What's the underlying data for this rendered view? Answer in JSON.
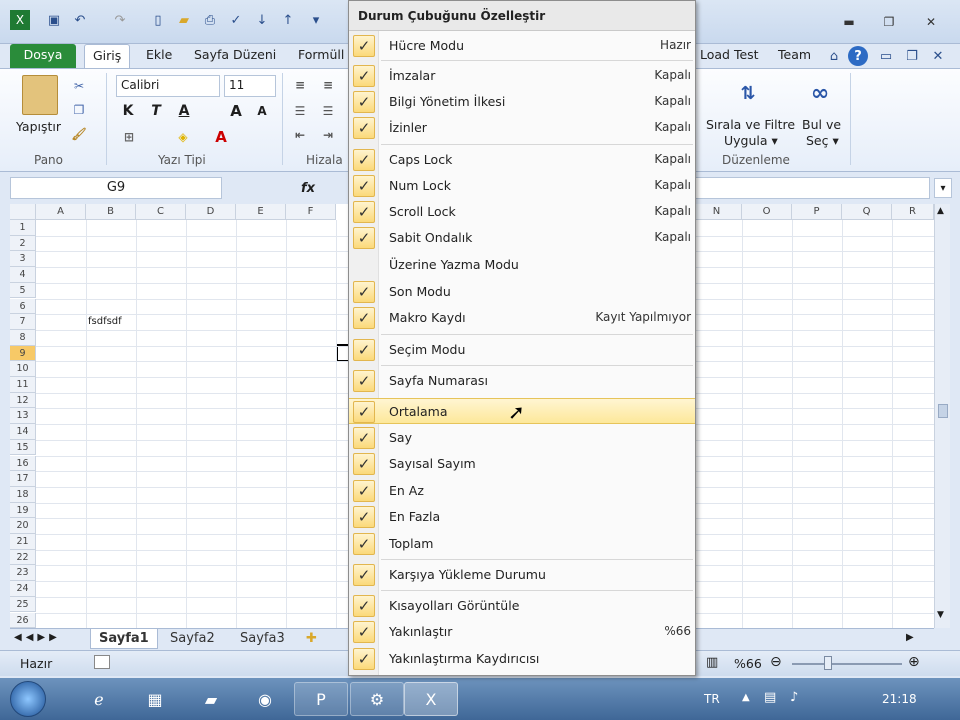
{
  "ribbon": {
    "tabs": [
      "Dosya",
      "Giriş",
      "Ekle",
      "Sayfa Düzeni",
      "Formüll",
      "Load Test",
      "Team"
    ],
    "paste_label": "Yapıştır",
    "font_name": "Calibri",
    "font_size": "11",
    "group_pano": "Pano",
    "group_yazi_tipi": "Yazı Tipi",
    "group_hizala": "Hizala",
    "group_duzenleme": "Düzenleme",
    "sort_label_1": "Sırala ve Filtre",
    "sort_label_2": "Uygula ▾",
    "find_label_1": "Bul ve",
    "find_label_2": "Seç ▾",
    "bold": "K",
    "italic": "T",
    "underline": "A",
    "grow_font": "A",
    "shrink_font": "A"
  },
  "formula_bar": {
    "name_box": "G9",
    "fx": "fx"
  },
  "grid": {
    "columns": [
      "A",
      "B",
      "C",
      "D",
      "E",
      "F",
      "N",
      "O",
      "P",
      "Q",
      "R"
    ],
    "rows": [
      "1",
      "2",
      "3",
      "4",
      "5",
      "6",
      "7",
      "8",
      "9",
      "10",
      "11",
      "12",
      "13",
      "14",
      "15",
      "16",
      "17",
      "18",
      "19",
      "20",
      "21",
      "22",
      "23",
      "24",
      "25",
      "26"
    ],
    "cell_b7": "fsdfsdf"
  },
  "sheets": [
    "Sayfa1",
    "Sayfa2",
    "Sayfa3"
  ],
  "status": {
    "ready": "Hazır",
    "zoom": "%66"
  },
  "taskbar": {
    "lang": "TR",
    "time": "21:18"
  },
  "menu": {
    "title": "Durum Çubuğunu Özelleştir",
    "items": [
      {
        "label": "Hücre Modu",
        "value": "Hazır",
        "checked": true
      },
      {
        "label": "İmzalar",
        "value": "Kapalı",
        "checked": true
      },
      {
        "label": "Bilgi Yönetim İlkesi",
        "value": "Kapalı",
        "checked": true
      },
      {
        "label": "İzinler",
        "value": "Kapalı",
        "checked": true
      },
      {
        "label": "Caps Lock",
        "value": "Kapalı",
        "checked": true
      },
      {
        "label": "Num Lock",
        "value": "Kapalı",
        "checked": true
      },
      {
        "label": "Scroll Lock",
        "value": "Kapalı",
        "checked": true
      },
      {
        "label": "Sabit Ondalık",
        "value": "Kapalı",
        "checked": true
      },
      {
        "label": "Üzerine Yazma Modu",
        "value": "",
        "checked": false
      },
      {
        "label": "Son Modu",
        "value": "",
        "checked": true
      },
      {
        "label": "Makro Kaydı",
        "value": "Kayıt Yapılmıyor",
        "checked": true
      },
      {
        "label": "Seçim Modu",
        "value": "",
        "checked": true
      },
      {
        "label": "Sayfa Numarası",
        "value": "",
        "checked": true
      },
      {
        "label": "Ortalama",
        "value": "",
        "checked": true
      },
      {
        "label": "Say",
        "value": "",
        "checked": true
      },
      {
        "label": "Sayısal Sayım",
        "value": "",
        "checked": true
      },
      {
        "label": "En Az",
        "value": "",
        "checked": true
      },
      {
        "label": "En Fazla",
        "value": "",
        "checked": true
      },
      {
        "label": "Toplam",
        "value": "",
        "checked": true
      },
      {
        "label": "Karşıya Yükleme Durumu",
        "value": "",
        "checked": true
      },
      {
        "label": "Kısayolları Görüntüle",
        "value": "",
        "checked": true
      },
      {
        "label": "Yakınlaştır",
        "value": "%66",
        "checked": true
      },
      {
        "label": "Yakınlaştırma Kaydırıcısı",
        "value": "",
        "checked": true
      }
    ]
  },
  "colors": {
    "file_tab": "#2a8c3a",
    "highlight": "#fde89a",
    "taskbar": "#3f6797"
  }
}
